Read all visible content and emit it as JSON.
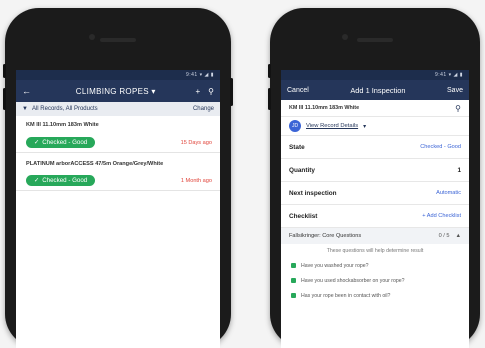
{
  "left_screen": {
    "status_text": "9:41 ▾ ◢ ▮",
    "app_title": "CLIMBING ROPES",
    "filter_label": "All Records, All Products",
    "change_label": "Change",
    "items": [
      {
        "name": "KM III 11.10mm 183m White",
        "status": "Checked - Good",
        "ago": "15 Days ago"
      },
      {
        "name": "PLATINUM arborACCESS 47/5m Orange/Grey/White",
        "status": "Checked - Good",
        "ago": "1 Month ago"
      }
    ]
  },
  "right_screen": {
    "status_text": "9:41 ▾ ◢ ▮",
    "cancel_label": "Cancel",
    "title": "Add 1 Inspection",
    "save_label": "Save",
    "item_name": "KM III 11.10mm 183m White",
    "record_link": "View Record Details",
    "avatar_initials": "JD",
    "fields": [
      {
        "label": "State",
        "value": "Checked - Good"
      },
      {
        "label": "Quantity",
        "value": "1"
      },
      {
        "label": "Next inspection",
        "value": "Automatic"
      },
      {
        "label": "Checklist",
        "value": "Add Checklist"
      }
    ],
    "section_title": "Fallsikringer: Core Questions",
    "section_progress": "0 / 5",
    "note": "These questions will help determine result",
    "questions": [
      "Have you washed your rope?",
      "Have you used shockabsorber on your rope?",
      "Has your rope been in contact with oil?"
    ]
  }
}
